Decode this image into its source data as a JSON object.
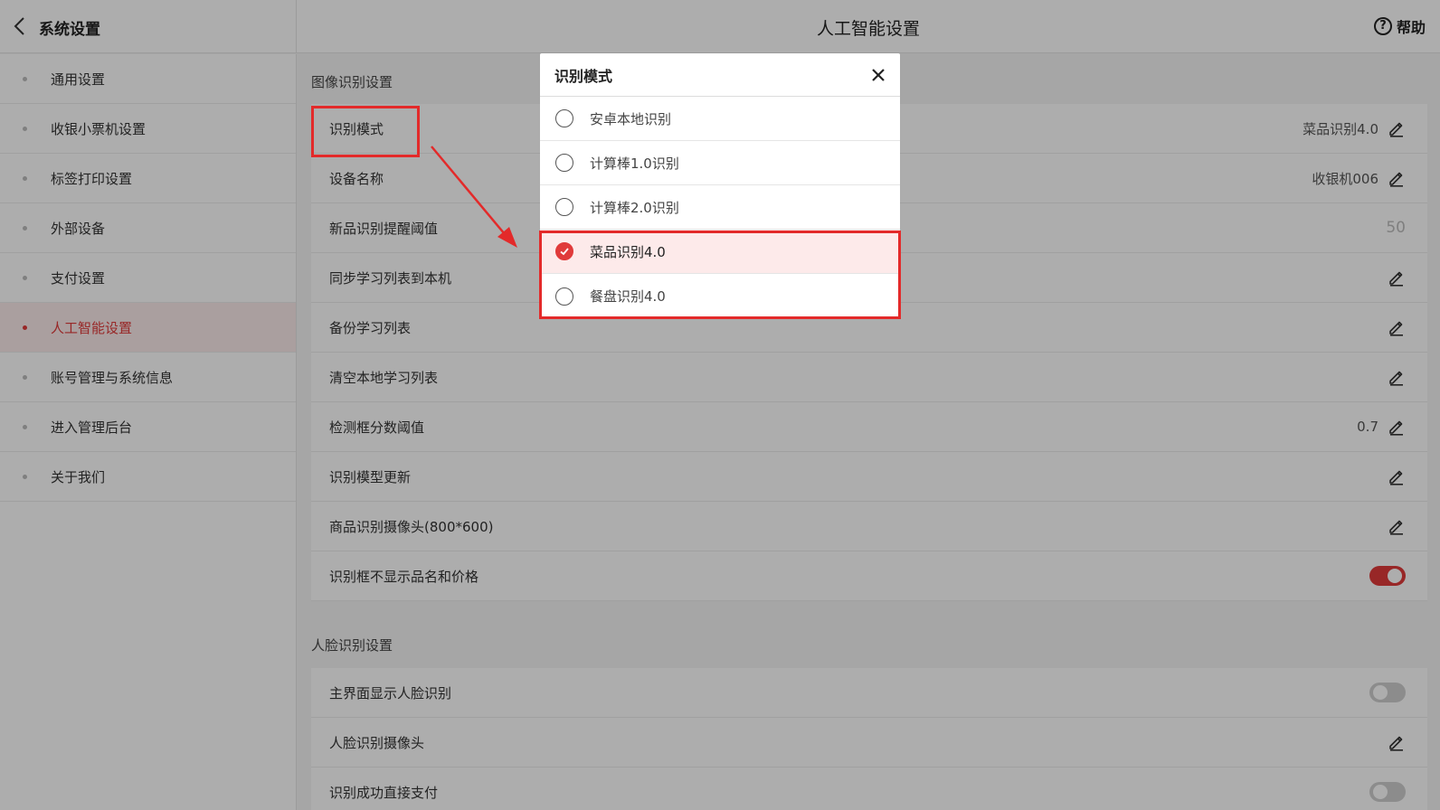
{
  "header": {
    "back_title": "系统设置",
    "title": "人工智能设置",
    "help_label": "帮助",
    "help_glyph": "?"
  },
  "sidebar": {
    "items": [
      {
        "label": "通用设置",
        "active": false
      },
      {
        "label": "收银小票机设置",
        "active": false
      },
      {
        "label": "标签打印设置",
        "active": false
      },
      {
        "label": "外部设备",
        "active": false
      },
      {
        "label": "支付设置",
        "active": false
      },
      {
        "label": "人工智能设置",
        "active": true
      },
      {
        "label": "账号管理与系统信息",
        "active": false
      },
      {
        "label": "进入管理后台",
        "active": false
      },
      {
        "label": "关于我们",
        "active": false
      }
    ]
  },
  "main": {
    "image_section_title": "图像识别设置",
    "image_rows": [
      {
        "label": "识别模式",
        "value": "菜品识别4.0",
        "control": "edit"
      },
      {
        "label": "设备名称",
        "value": "收银机006",
        "control": "edit"
      },
      {
        "label": "新品识别提醒阈值",
        "value": "50",
        "control": "muted"
      },
      {
        "label": "同步学习列表到本机",
        "value": "",
        "control": "edit"
      },
      {
        "label": "备份学习列表",
        "value": "",
        "control": "edit"
      },
      {
        "label": "清空本地学习列表",
        "value": "",
        "control": "edit"
      },
      {
        "label": "检测框分数阈值",
        "value": "0.7",
        "control": "edit"
      },
      {
        "label": "识别模型更新",
        "value": "",
        "control": "edit"
      },
      {
        "label": "商品识别摄像头(800*600)",
        "value": "",
        "control": "edit"
      },
      {
        "label": "识别框不显示品名和价格",
        "value": "",
        "control": "toggle-on"
      }
    ],
    "face_section_title": "人脸识别设置",
    "face_rows": [
      {
        "label": "主界面显示人脸识别",
        "value": "",
        "control": "toggle-off"
      },
      {
        "label": "人脸识别摄像头",
        "value": "",
        "control": "edit"
      },
      {
        "label": "识别成功直接支付",
        "value": "",
        "control": "toggle-off"
      }
    ]
  },
  "dialog": {
    "title": "识别模式",
    "options": [
      {
        "label": "安卓本地识别",
        "selected": false
      },
      {
        "label": "计算棒1.0识别",
        "selected": false
      },
      {
        "label": "计算棒2.0识别",
        "selected": false
      },
      {
        "label": "菜品识别4.0",
        "selected": true
      },
      {
        "label": "餐盘识别4.0",
        "selected": false
      }
    ]
  },
  "colors": {
    "accent": "#e03a3a",
    "annotation": "#e32a2a"
  }
}
